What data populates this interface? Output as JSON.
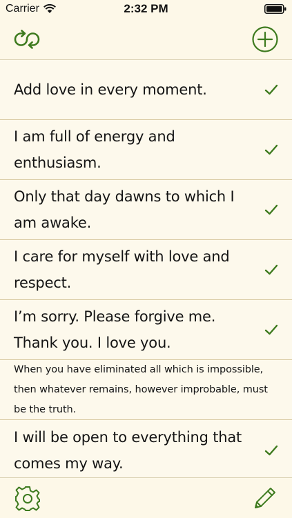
{
  "status_bar": {
    "carrier": "Carrier",
    "time": "2:32 PM"
  },
  "nav": {
    "left_icon": "refresh-cycle-icon",
    "right_icon": "add-circle-icon"
  },
  "colors": {
    "accent": "#3d7a1e",
    "background": "#fdf9ec",
    "separator": "#d8c9a0"
  },
  "affirmations": [
    {
      "text": "Add love in every moment.",
      "checked": true
    },
    {
      "text": "I am full of energy and enthusiasm.",
      "checked": true
    },
    {
      "text": "Only that day dawns to which I am awake.",
      "checked": true
    },
    {
      "text": "I care for myself with love and respect.",
      "checked": true
    },
    {
      "text": "I’m sorry. Please forgive me. Thank you. I love you.",
      "checked": true
    },
    {
      "text": "When you have eliminated all which is impossible, then whatever remains, however improbable, must be the truth.",
      "checked": false
    },
    {
      "text": "I will be open to everything that comes my way.",
      "checked": true
    }
  ],
  "tab_bar": {
    "left_icon": "gear-icon",
    "right_icon": "pencil-icon"
  }
}
